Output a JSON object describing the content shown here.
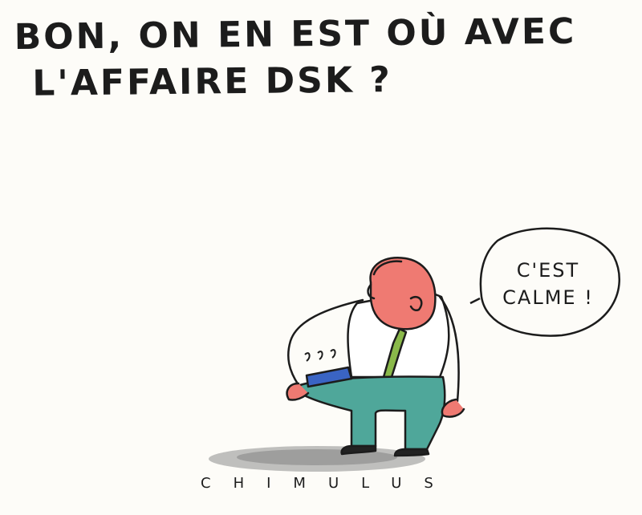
{
  "cartoon": {
    "caption_line1": "BON, ON EN EST OÙ AVEC",
    "caption_line2": "L'AFFAIRE DSK ?",
    "speech_line1": "C'EST",
    "speech_line2": "CALME !",
    "signature": "CHIMULUS"
  },
  "colors": {
    "background": "#fdfcf8",
    "ink": "#1c1c1c",
    "face": "#ef7a72",
    "pants": "#4fa79a",
    "tie": "#8ab94a",
    "shadow": "#8c8c8c"
  }
}
